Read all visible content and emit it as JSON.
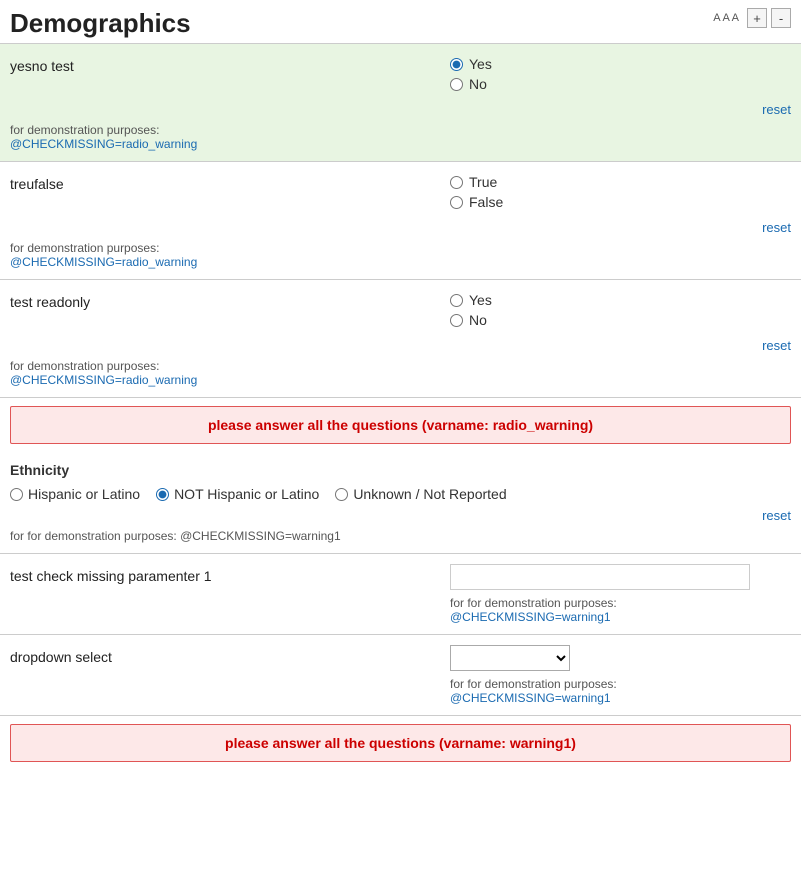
{
  "header": {
    "title": "Demographics",
    "font_label": "A A A",
    "zoom_in": "+",
    "zoom_out": "-"
  },
  "sections": {
    "yesno": {
      "label": "yesno test",
      "options": [
        "Yes",
        "No"
      ],
      "selected": "Yes",
      "reset_label": "reset",
      "demo_prefix": "for demonstration purposes:",
      "demo_var": "@CHECKMISSING=radio_warning"
    },
    "treufalse": {
      "label": "treufalse",
      "options": [
        "True",
        "False"
      ],
      "selected": "",
      "reset_label": "reset",
      "demo_prefix": "for demonstration purposes:",
      "demo_var": "@CHECKMISSING=radio_warning"
    },
    "test_readonly": {
      "label": "test readonly",
      "options": [
        "Yes",
        "No"
      ],
      "selected": "",
      "reset_label": "reset",
      "demo_prefix": "for demonstration purposes:",
      "demo_var": "@CHECKMISSING=radio_warning"
    },
    "warning1": {
      "message": "please answer all the questions (varname: radio_warning)"
    },
    "ethnicity": {
      "title": "Ethnicity",
      "options": [
        "Hispanic or Latino",
        "NOT Hispanic or Latino",
        "Unknown / Not Reported"
      ],
      "selected": "NOT Hispanic or Latino",
      "reset_label": "reset",
      "demo_text": "for for demonstration purposes: @CHECKMISSING=warning1"
    },
    "check_missing1": {
      "label": "test check missing paramenter 1",
      "value": "",
      "demo_prefix": "for for demonstration purposes:",
      "demo_var": "@CHECKMISSING=warning1"
    },
    "dropdown": {
      "label": "dropdown select",
      "options": [
        ""
      ],
      "selected": "",
      "demo_prefix": "for for demonstration purposes:",
      "demo_var": "@CHECKMISSING=warning1"
    },
    "warning2": {
      "message": "please answer all the questions (varname: warning1)"
    }
  }
}
